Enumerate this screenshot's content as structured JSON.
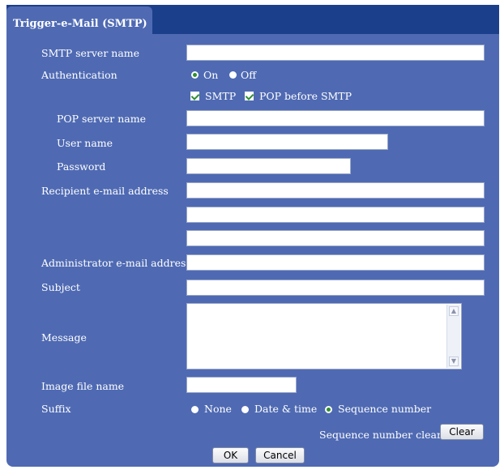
{
  "tab": {
    "label": "Trigger-e-Mail (SMTP)"
  },
  "form": {
    "smtp_server_name": {
      "label": "SMTP server name",
      "value": ""
    },
    "authentication": {
      "label": "Authentication",
      "on_label": "On",
      "off_label": "Off",
      "selected": "On",
      "smtp_label": "SMTP",
      "smtp_checked": true,
      "pop_before_smtp_label": "POP before SMTP",
      "pop_before_smtp_checked": true
    },
    "pop_server_name": {
      "label": "POP server name",
      "value": ""
    },
    "user_name": {
      "label": "User name",
      "value": ""
    },
    "password": {
      "label": "Password",
      "value": ""
    },
    "recipient": {
      "label": "Recipient e-mail address",
      "values": [
        "",
        "",
        ""
      ]
    },
    "administrator": {
      "label": "Administrator e-mail address",
      "value": ""
    },
    "subject": {
      "label": "Subject",
      "value": ""
    },
    "message": {
      "label": "Message",
      "value": ""
    },
    "image_file_name": {
      "label": "Image file name",
      "value": ""
    },
    "suffix": {
      "label": "Suffix",
      "options": [
        "None",
        "Date & time",
        "Sequence number"
      ],
      "selected": "Sequence number"
    },
    "sequence_number_clear": {
      "label": "Sequence number clear",
      "button": "Clear"
    }
  },
  "buttons": {
    "ok": "OK",
    "cancel": "Cancel"
  },
  "colors": {
    "header": "#1c3f8c",
    "panel": "#4f6ab3",
    "radio_selected": "#2f8f2f"
  }
}
